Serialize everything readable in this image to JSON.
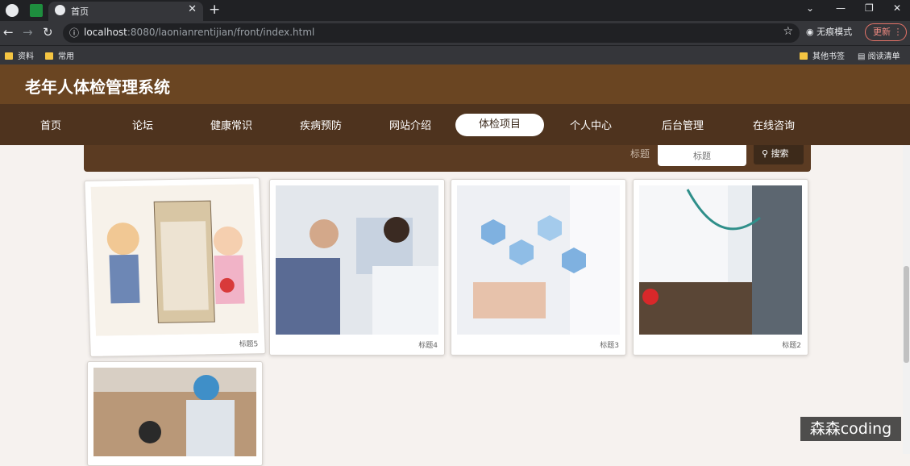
{
  "browser": {
    "tab_title": "首页",
    "url_host": "localhost",
    "url_path": ":8080/laonianrentijian/front/index.html",
    "incognito_label": "无痕模式",
    "update_label": "更新",
    "bookmarks": [
      "资料",
      "常用"
    ],
    "bookmarks_right": [
      "其他书签",
      "阅读清单"
    ]
  },
  "site": {
    "title": "老年人体检管理系统",
    "nav": [
      "首页",
      "论坛",
      "健康常识",
      "疾病预防",
      "网站介绍",
      "体检项目",
      "个人中心",
      "后台管理",
      "在线咨询"
    ],
    "active_nav": "体检项目"
  },
  "search": {
    "label": "标题",
    "placeholder": "标题",
    "button_label": "搜索"
  },
  "cards": [
    {
      "caption": "标题5"
    },
    {
      "caption": "标题4"
    },
    {
      "caption": "标题3"
    },
    {
      "caption": "标题2"
    },
    {
      "caption": ""
    }
  ],
  "watermark": "森森coding",
  "colors": {
    "header": "#6a4522",
    "nav": "#4e331e",
    "search_bar": "#5b3b22"
  }
}
